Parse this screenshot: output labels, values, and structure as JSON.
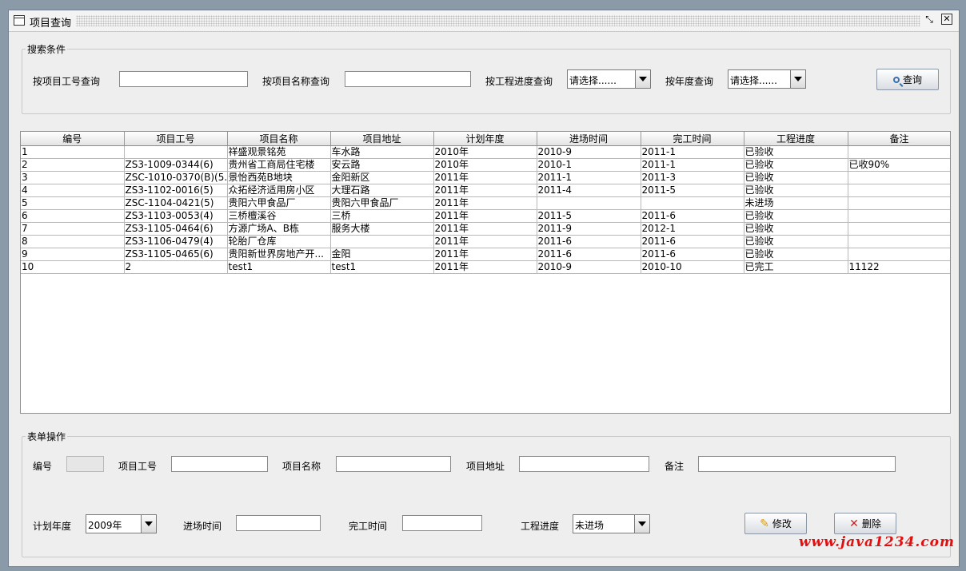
{
  "window": {
    "title": "项目查询"
  },
  "search": {
    "group_title": "搜索条件",
    "id_label": "按项目工号查询",
    "id_value": "",
    "name_label": "按项目名称查询",
    "name_value": "",
    "progress_label": "按工程进度查询",
    "progress_selected": "请选择......",
    "year_label": "按年度查询",
    "year_selected": "请选择......",
    "query_button": "查询"
  },
  "table": {
    "columns": [
      "编号",
      "项目工号",
      "项目名称",
      "项目地址",
      "计划年度",
      "进场时间",
      "完工时间",
      "工程进度",
      "备注"
    ],
    "rows": [
      [
        "1",
        "",
        "祥盛观景铭苑",
        "车水路",
        "2010年",
        "2010-9",
        "2011-1",
        "已验收",
        ""
      ],
      [
        "2",
        "ZS3-1009-0344(6)",
        "贵州省工商局住宅楼",
        "安云路",
        "2010年",
        "2010-1",
        "2011-1",
        "已验收",
        "已收90%"
      ],
      [
        "3",
        "ZSC-1010-0370(B)(5...",
        "景怡西苑B地块",
        "金阳新区",
        "2011年",
        "2011-1",
        "2011-3",
        "已验收",
        ""
      ],
      [
        "4",
        "ZS3-1102-0016(5)",
        "众拓经济适用房小区",
        "大理石路",
        "2011年",
        "2011-4",
        "2011-5",
        "已验收",
        ""
      ],
      [
        "5",
        "ZSC-1104-0421(5)",
        "贵阳六甲食品厂",
        "贵阳六甲食品厂",
        "2011年",
        "",
        "",
        "未进场",
        ""
      ],
      [
        "6",
        "ZS3-1103-0053(4)",
        "三桥檀溪谷",
        "三桥",
        "2011年",
        "2011-5",
        "2011-6",
        "已验收",
        ""
      ],
      [
        "7",
        "ZS3-1105-0464(6)",
        "方源广场A、B栋",
        "服务大楼",
        "2011年",
        "2011-9",
        "2012-1",
        "已验收",
        ""
      ],
      [
        "8",
        "ZS3-1106-0479(4)",
        "轮胎厂仓库",
        "",
        "2011年",
        "2011-6",
        "2011-6",
        "已验收",
        ""
      ],
      [
        "9",
        "ZS3-1105-0465(6)",
        "贵阳新世界房地产开...",
        "金阳",
        "2011年",
        "2011-6",
        "2011-6",
        "已验收",
        ""
      ],
      [
        "10",
        "2",
        "test1",
        "test1",
        "2011年",
        "2010-9",
        "2010-10",
        "已完工",
        "11122"
      ]
    ]
  },
  "form": {
    "group_title": "表单操作",
    "id_label": "编号",
    "id_value": "",
    "code_label": "项目工号",
    "code_value": "",
    "name_label": "项目名称",
    "name_value": "",
    "address_label": "项目地址",
    "address_value": "",
    "note_label": "备注",
    "note_value": "",
    "year_label": "计划年度",
    "year_selected": "2009年",
    "entry_label": "进场时间",
    "entry_value": "",
    "finish_label": "完工时间",
    "finish_value": "",
    "progress_label": "工程进度",
    "progress_selected": "未进场",
    "modify_button": "修改",
    "delete_button": "删除"
  },
  "watermark": "www.java1234.com"
}
